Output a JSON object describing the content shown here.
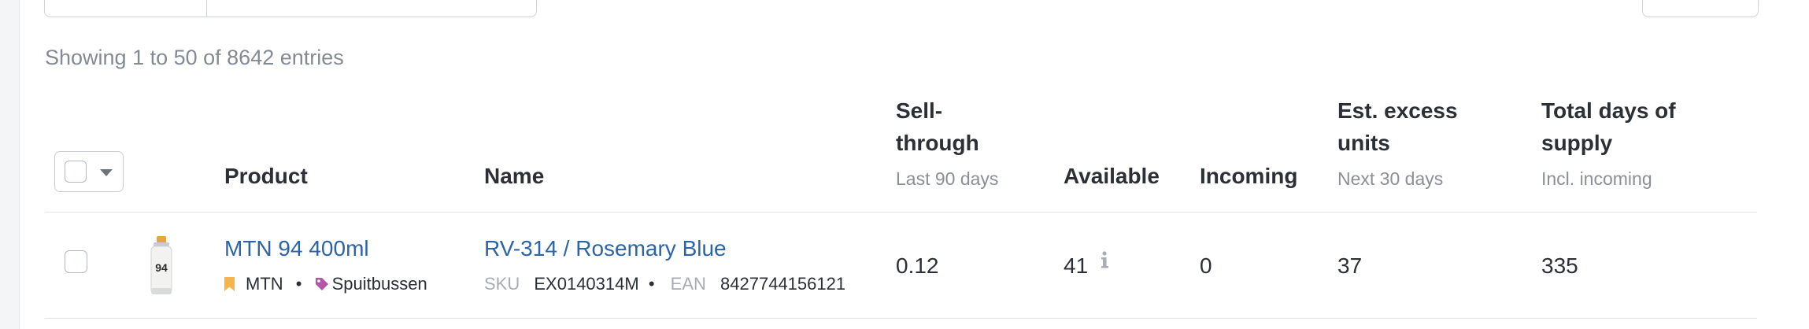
{
  "entries_text": "Showing 1 to 50 of 8642 entries",
  "columns": {
    "product": "Product",
    "name": "Name",
    "sell_through": {
      "line1": "Sell-",
      "line2": "through",
      "sub": "Last 90 days"
    },
    "available": "Available",
    "incoming": "Incoming",
    "excess": {
      "line1": "Est. excess",
      "line2": "units",
      "sub": "Next 30 days"
    },
    "supply": {
      "line1": "Total days of",
      "line2": "supply",
      "sub": "Incl. incoming"
    }
  },
  "row": {
    "product": "MTN 94 400ml",
    "brand": "MTN",
    "category": "Spuitbussen",
    "name": "RV-314 / Rosemary Blue",
    "sku_label": "SKU",
    "sku": "EX0140314M",
    "ean_label": "EAN",
    "ean": "8427744156121",
    "sell_through": "0.12",
    "available": "41",
    "incoming": "0",
    "excess": "37",
    "supply": "335",
    "can_label": "94"
  },
  "icons": {
    "brand": "bookmark-icon",
    "category": "tag-icon",
    "info": "info-icon",
    "bulk_caret": "chevron-down-icon"
  },
  "colors": {
    "link": "#2c64a8",
    "bookmark": "#f5b54a",
    "tag": "#b456a8"
  }
}
